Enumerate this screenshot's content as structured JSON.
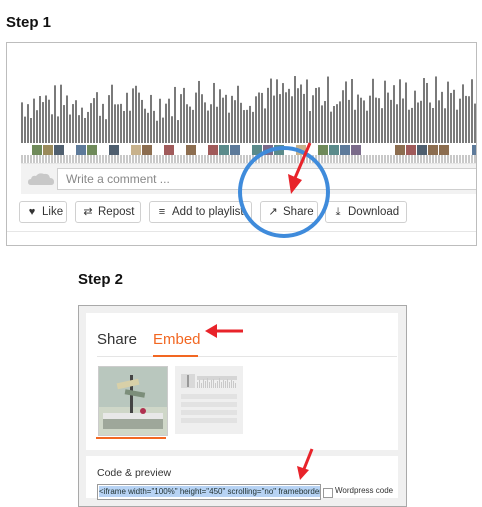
{
  "step1": {
    "title": "Step 1",
    "comment_placeholder": "Write a comment ...",
    "buttons": {
      "like": "Like",
      "repost": "Repost",
      "add_to_playlist": "Add to playlist",
      "share": "Share",
      "download": "Download"
    },
    "icons": {
      "like": "heart-icon",
      "repost": "repost-icon",
      "add_to_playlist": "playlist-add-icon",
      "share": "share-icon",
      "download": "download-icon",
      "avatar": "soundcloud-cloud-icon"
    }
  },
  "step2": {
    "title": "Step 2",
    "tabs": [
      "Share",
      "Embed"
    ],
    "active_tab": "Embed",
    "code_label": "Code & preview",
    "code_value": "<iframe width=\"100%\" height=\"450\" scrolling=\"no\" frameborder",
    "wordpress_label": "Wordpress code",
    "wordpress_checked": false
  },
  "colors": {
    "accent_orange": "#f26722",
    "highlight_circle": "#3f8bdb",
    "annotation_arrow": "#e8232a",
    "waveform_bar": "#7a7a7a"
  }
}
